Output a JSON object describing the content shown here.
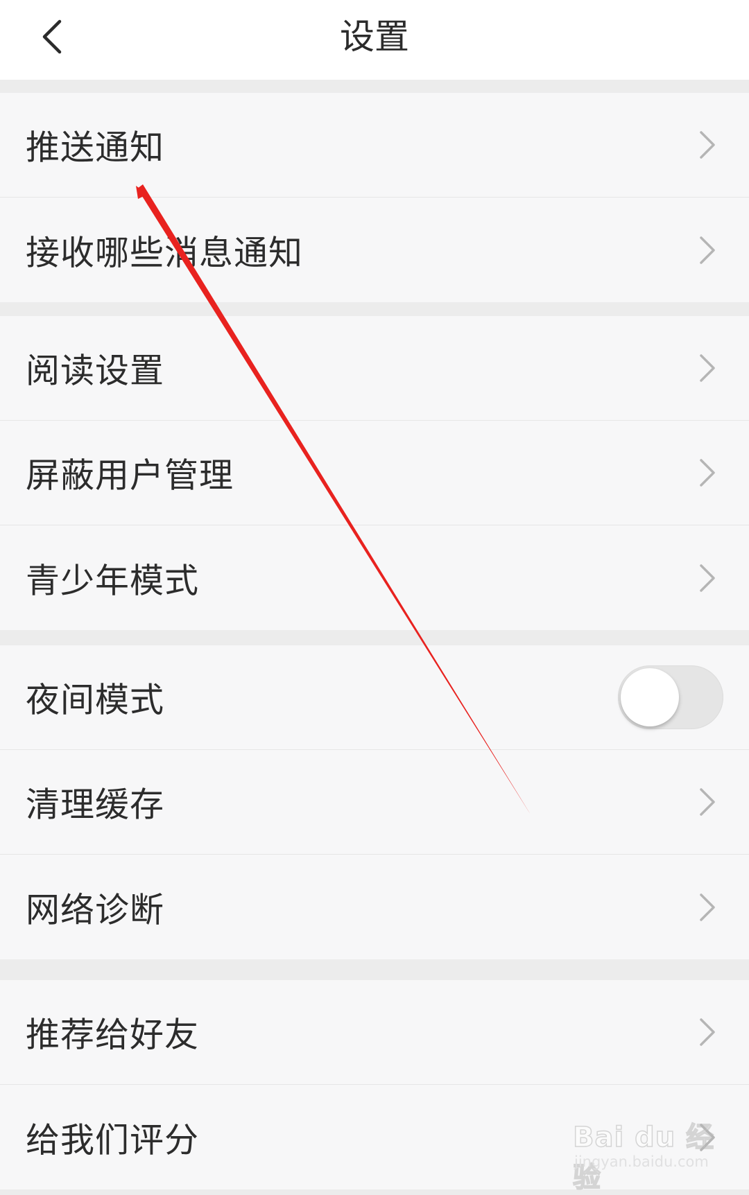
{
  "header": {
    "title": "设置",
    "back_icon": "chevron-left-icon"
  },
  "groups": [
    {
      "items": [
        {
          "label": "推送通知",
          "control": "chevron"
        },
        {
          "label": "接收哪些消息通知",
          "control": "chevron"
        }
      ]
    },
    {
      "items": [
        {
          "label": "阅读设置",
          "control": "chevron"
        },
        {
          "label": "屏蔽用户管理",
          "control": "chevron"
        },
        {
          "label": "青少年模式",
          "control": "chevron"
        }
      ]
    },
    {
      "items": [
        {
          "label": "夜间模式",
          "control": "toggle",
          "toggle_on": false
        },
        {
          "label": "清理缓存",
          "control": "chevron"
        },
        {
          "label": "网络诊断",
          "control": "chevron"
        }
      ]
    },
    {
      "items": [
        {
          "label": "推荐给好友",
          "control": "chevron"
        },
        {
          "label": "给我们评分",
          "control": "chevron"
        }
      ]
    }
  ],
  "watermark": {
    "brand": "Bai du 经验",
    "url": "jingyan.baidu.com"
  },
  "colors": {
    "background": "#ececec",
    "row_background": "#f7f7f8",
    "text": "#2c2c2c",
    "chevron": "#b5b5b5",
    "annotation_arrow": "#e8221f"
  }
}
